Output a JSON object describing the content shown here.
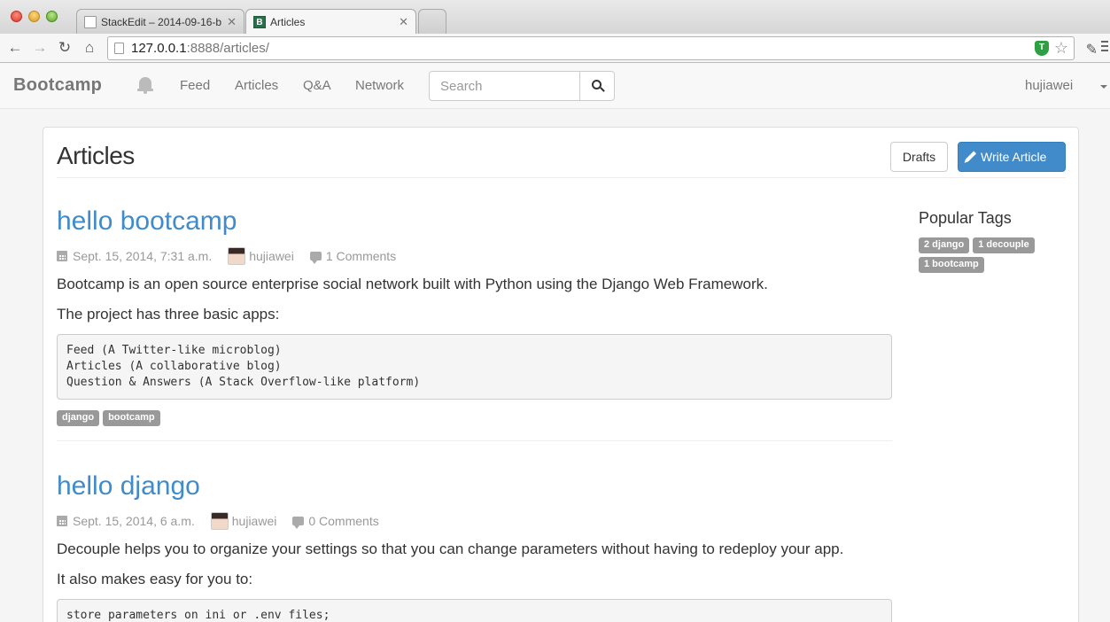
{
  "browser": {
    "tabs": [
      {
        "title": "StackEdit – 2014-09-16-b",
        "active": false
      },
      {
        "title": "Articles",
        "active": true
      }
    ],
    "url_host": "127.0.0.1",
    "url_rest": ":8888/articles/"
  },
  "navbar": {
    "brand": "Bootcamp",
    "links": [
      "Feed",
      "Articles",
      "Q&A",
      "Network"
    ],
    "search_placeholder": "Search",
    "username": "hujiawei"
  },
  "page": {
    "title": "Articles",
    "drafts_label": "Drafts",
    "write_label": "Write Article"
  },
  "articles": [
    {
      "title": "hello bootcamp",
      "date": "Sept. 15, 2014, 7:31 a.m.",
      "author": "hujiawei",
      "comments": "1 Comments",
      "paragraphs": [
        "Bootcamp is an open source enterprise social network built with Python using the Django Web Framework.",
        "The project has three basic apps:"
      ],
      "code": "Feed (A Twitter-like microblog)\nArticles (A collaborative blog)\nQuestion & Answers (A Stack Overflow-like platform)",
      "tags": [
        "django",
        "bootcamp"
      ]
    },
    {
      "title": "hello django",
      "date": "Sept. 15, 2014, 6 a.m.",
      "author": "hujiawei",
      "comments": "0 Comments",
      "paragraphs": [
        "Decouple helps you to organize your settings so that you can change parameters without having to redeploy your app.",
        "It also makes easy for you to:"
      ],
      "code": "store parameters on ini or .env files;"
    }
  ],
  "sidebar": {
    "heading": "Popular Tags",
    "tags": [
      "2 django",
      "1 decouple",
      "1 bootcamp"
    ]
  }
}
